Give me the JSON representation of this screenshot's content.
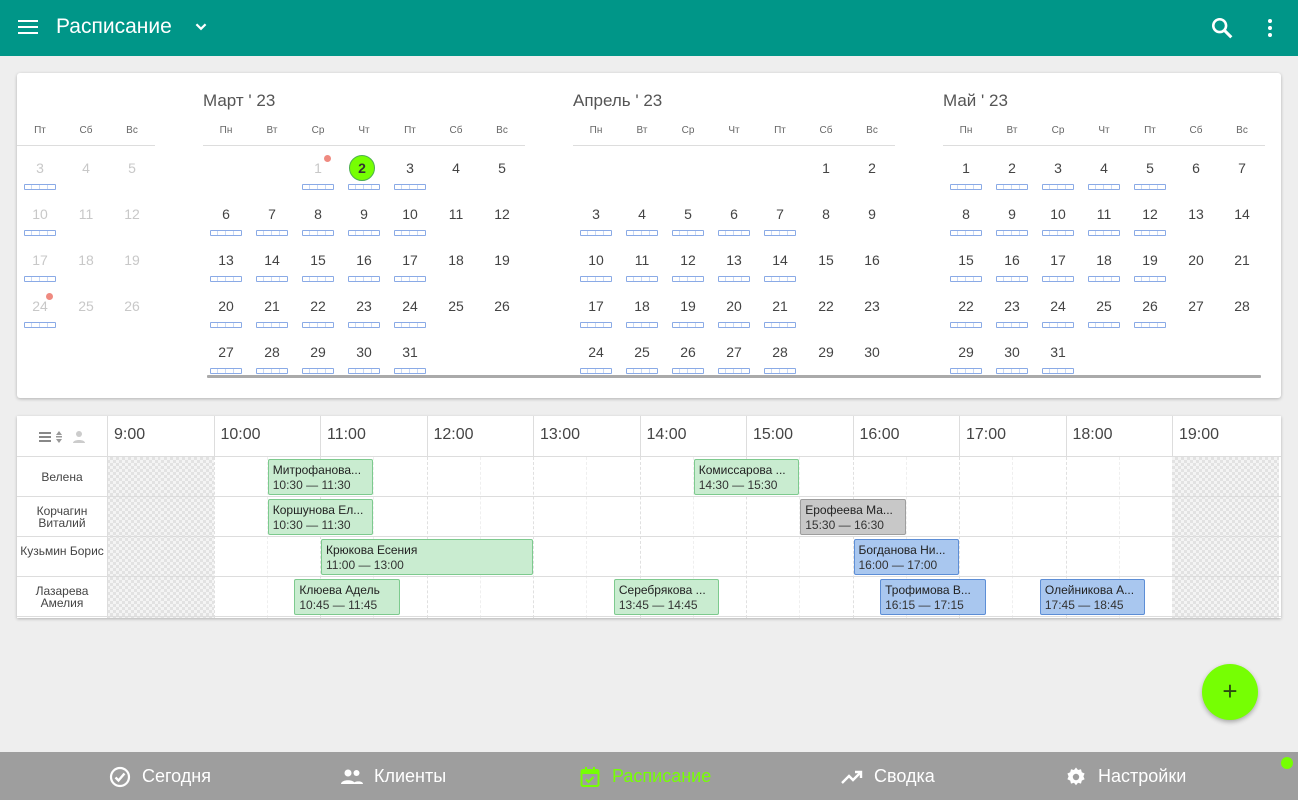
{
  "appbar": {
    "title": "Расписание",
    "icons": {
      "menu": "menu-icon",
      "dropdown": "chevron-down-icon",
      "search": "search-icon",
      "more": "more-vert-icon"
    }
  },
  "calendar": {
    "months": [
      {
        "title": "",
        "weekdays": [
          "Пт",
          "Сб",
          "Вс"
        ],
        "days": [
          {
            "d": "3",
            "dim": true,
            "appts": true
          },
          {
            "d": "4",
            "dim": true
          },
          {
            "d": "5",
            "dim": true
          },
          {
            "d": "10",
            "dim": true,
            "appts": true
          },
          {
            "d": "11",
            "dim": true
          },
          {
            "d": "12",
            "dim": true
          },
          {
            "d": "17",
            "dim": true,
            "appts": true
          },
          {
            "d": "18",
            "dim": true
          },
          {
            "d": "19",
            "dim": true
          },
          {
            "d": "24",
            "dim": true,
            "appts": true,
            "dot": true
          },
          {
            "d": "25",
            "dim": true
          },
          {
            "d": "26",
            "dim": true
          }
        ]
      },
      {
        "title": "Март ' 23",
        "weekdays": [
          "Пн",
          "Вт",
          "Ср",
          "Чт",
          "Пт",
          "Сб",
          "Вс"
        ],
        "days": [
          {
            "d": ""
          },
          {
            "d": ""
          },
          {
            "d": "1",
            "dim": true,
            "appts": true,
            "dot": true
          },
          {
            "d": "2",
            "today": true,
            "appts": true
          },
          {
            "d": "3",
            "appts": true
          },
          {
            "d": "4"
          },
          {
            "d": "5"
          },
          {
            "d": "6",
            "appts": true
          },
          {
            "d": "7",
            "appts": true
          },
          {
            "d": "8",
            "appts": true
          },
          {
            "d": "9",
            "appts": true
          },
          {
            "d": "10",
            "appts": true
          },
          {
            "d": "11"
          },
          {
            "d": "12"
          },
          {
            "d": "13",
            "appts": true
          },
          {
            "d": "14",
            "appts": true
          },
          {
            "d": "15",
            "appts": true
          },
          {
            "d": "16",
            "appts": true
          },
          {
            "d": "17",
            "appts": true
          },
          {
            "d": "18"
          },
          {
            "d": "19"
          },
          {
            "d": "20",
            "appts": true
          },
          {
            "d": "21",
            "appts": true
          },
          {
            "d": "22",
            "appts": true
          },
          {
            "d": "23",
            "appts": true
          },
          {
            "d": "24",
            "appts": true
          },
          {
            "d": "25"
          },
          {
            "d": "26"
          },
          {
            "d": "27",
            "appts": true
          },
          {
            "d": "28",
            "appts": true
          },
          {
            "d": "29",
            "appts": true
          },
          {
            "d": "30",
            "appts": true
          },
          {
            "d": "31",
            "appts": true
          }
        ]
      },
      {
        "title": "Апрель ' 23",
        "weekdays": [
          "Пн",
          "Вт",
          "Ср",
          "Чт",
          "Пт",
          "Сб",
          "Вс"
        ],
        "days": [
          {
            "d": ""
          },
          {
            "d": ""
          },
          {
            "d": ""
          },
          {
            "d": ""
          },
          {
            "d": ""
          },
          {
            "d": "1"
          },
          {
            "d": "2"
          },
          {
            "d": "3",
            "appts": true
          },
          {
            "d": "4",
            "appts": true
          },
          {
            "d": "5",
            "appts": true
          },
          {
            "d": "6",
            "appts": true
          },
          {
            "d": "7",
            "appts": true
          },
          {
            "d": "8"
          },
          {
            "d": "9"
          },
          {
            "d": "10",
            "appts": true
          },
          {
            "d": "11",
            "appts": true
          },
          {
            "d": "12",
            "appts": true
          },
          {
            "d": "13",
            "appts": true
          },
          {
            "d": "14",
            "appts": true
          },
          {
            "d": "15"
          },
          {
            "d": "16"
          },
          {
            "d": "17",
            "appts": true
          },
          {
            "d": "18",
            "appts": true
          },
          {
            "d": "19",
            "appts": true
          },
          {
            "d": "20",
            "appts": true
          },
          {
            "d": "21",
            "appts": true
          },
          {
            "d": "22"
          },
          {
            "d": "23"
          },
          {
            "d": "24",
            "appts": true
          },
          {
            "d": "25",
            "appts": true
          },
          {
            "d": "26",
            "appts": true
          },
          {
            "d": "27",
            "appts": true
          },
          {
            "d": "28",
            "appts": true
          },
          {
            "d": "29"
          },
          {
            "d": "30"
          }
        ]
      },
      {
        "title": "Май ' 23",
        "weekdays": [
          "Пн",
          "Вт",
          "Ср",
          "Чт",
          "Пт",
          "Сб",
          "Вс"
        ],
        "days": [
          {
            "d": "1",
            "appts": true
          },
          {
            "d": "2",
            "appts": true
          },
          {
            "d": "3",
            "appts": true
          },
          {
            "d": "4",
            "appts": true
          },
          {
            "d": "5",
            "appts": true
          },
          {
            "d": "6"
          },
          {
            "d": "7"
          },
          {
            "d": "8",
            "appts": true
          },
          {
            "d": "9",
            "appts": true
          },
          {
            "d": "10",
            "appts": true
          },
          {
            "d": "11",
            "appts": true
          },
          {
            "d": "12",
            "appts": true
          },
          {
            "d": "13"
          },
          {
            "d": "14"
          },
          {
            "d": "15",
            "appts": true
          },
          {
            "d": "16",
            "appts": true
          },
          {
            "d": "17",
            "appts": true
          },
          {
            "d": "18",
            "appts": true
          },
          {
            "d": "19",
            "appts": true
          },
          {
            "d": "20"
          },
          {
            "d": "21"
          },
          {
            "d": "22",
            "appts": true
          },
          {
            "d": "23",
            "appts": true
          },
          {
            "d": "24",
            "appts": true
          },
          {
            "d": "25",
            "appts": true
          },
          {
            "d": "26",
            "appts": true
          },
          {
            "d": "27"
          },
          {
            "d": "28"
          },
          {
            "d": "29",
            "appts": true
          },
          {
            "d": "30",
            "appts": true
          },
          {
            "d": "31",
            "appts": true
          }
        ]
      }
    ]
  },
  "schedule": {
    "tool_icons": [
      "list-view-icon",
      "sort-icon",
      "person-icon"
    ],
    "hours": [
      "9:00",
      "10:00",
      "11:00",
      "12:00",
      "13:00",
      "14:00",
      "15:00",
      "16:00",
      "17:00",
      "18:00",
      "19:00"
    ],
    "staff": [
      {
        "name": "Велена",
        "appointments": [
          {
            "client": "Митрофанова...",
            "time": "10:30 — 11:30",
            "start": 10.5,
            "end": 11.5,
            "color": "green"
          },
          {
            "client": "Комиссарова ...",
            "time": "14:30 — 15:30",
            "start": 14.5,
            "end": 15.5,
            "color": "green"
          }
        ]
      },
      {
        "name": "Корчагин Виталий",
        "appointments": [
          {
            "client": "Коршунова Ел...",
            "time": "10:30 — 11:30",
            "start": 10.5,
            "end": 11.5,
            "color": "green"
          },
          {
            "client": "Ерофеева Ма...",
            "time": "15:30 — 16:30",
            "start": 15.5,
            "end": 16.5,
            "color": "gray"
          }
        ]
      },
      {
        "name": "Кузьмин Борис",
        "appointments": [
          {
            "client": "Крюкова Есения",
            "time": "11:00 — 13:00",
            "start": 11.0,
            "end": 13.0,
            "color": "green"
          },
          {
            "client": "Богданова Ни...",
            "time": "16:00 — 17:00",
            "start": 16.0,
            "end": 17.0,
            "color": "blue"
          }
        ]
      },
      {
        "name": "Лазарева Амелия",
        "appointments": [
          {
            "client": "Клюева Адель",
            "time": "10:45 — 11:45",
            "start": 10.75,
            "end": 11.75,
            "color": "green"
          },
          {
            "client": "Серебрякова ...",
            "time": "13:45 — 14:45",
            "start": 13.75,
            "end": 14.75,
            "color": "green"
          },
          {
            "client": "Трофимова В...",
            "time": "16:15 — 17:15",
            "start": 16.25,
            "end": 17.25,
            "color": "blue"
          },
          {
            "client": "Олейникова А...",
            "time": "17:45 — 18:45",
            "start": 17.75,
            "end": 18.75,
            "color": "blue"
          }
        ]
      }
    ]
  },
  "fab": {
    "label": "+"
  },
  "bottom_nav": [
    {
      "label": "Сегодня",
      "icon": "check-circle-icon",
      "active": false
    },
    {
      "label": "Клиенты",
      "icon": "people-icon",
      "active": false
    },
    {
      "label": "Расписание",
      "icon": "calendar-check-icon",
      "active": true
    },
    {
      "label": "Сводка",
      "icon": "trending-up-icon",
      "active": false
    },
    {
      "label": "Настройки",
      "icon": "gear-icon",
      "active": false
    }
  ],
  "colors": {
    "primary": "#009688",
    "accent": "#76ff03",
    "nav_bg": "#9e9e9e",
    "appt_green": "#c9ecd0",
    "appt_blue": "#a9c7ef",
    "appt_gray": "#c8c8c8"
  }
}
